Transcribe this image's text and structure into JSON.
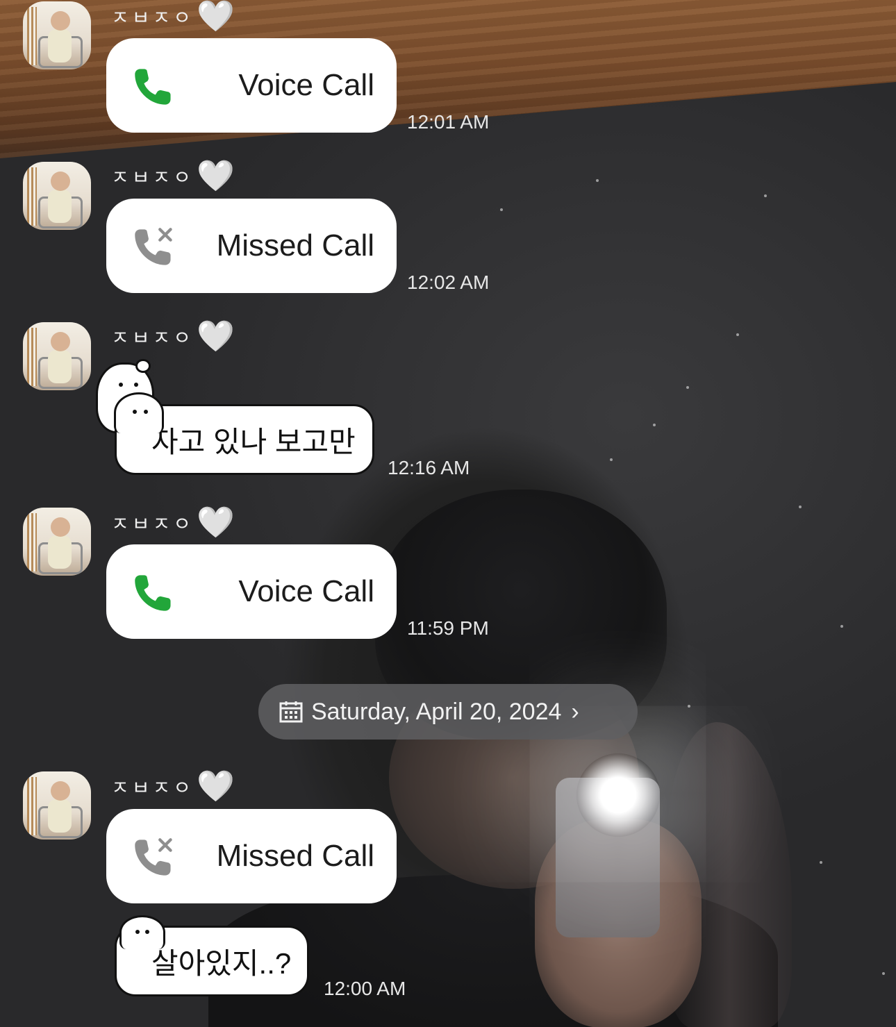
{
  "contact": {
    "name": "ㅈㅂㅈㅇ",
    "heart": "🤍"
  },
  "colors": {
    "call_green": "#22a63a",
    "missed_gray": "#8e8e8e",
    "bubble": "#ffffff"
  },
  "messages": [
    {
      "type": "call",
      "icon": "phone-icon",
      "label": "Voice Call",
      "time": "12:01 AM"
    },
    {
      "type": "call",
      "icon": "missed-call-icon",
      "label": "Missed Call",
      "time": "12:02 AM"
    },
    {
      "type": "sticker_text",
      "text": "자고 있나 보고만",
      "time": "12:16 AM"
    },
    {
      "type": "call",
      "icon": "phone-icon",
      "label": "Voice Call",
      "time": "11:59 PM"
    },
    {
      "type": "call",
      "icon": "missed-call-icon",
      "label": "Missed Call",
      "time": ""
    },
    {
      "type": "sticker_text",
      "text": "살아있지..?",
      "time": "12:00 AM"
    }
  ],
  "date_divider": {
    "icon": "calendar-icon",
    "label": "Saturday, April 20, 2024",
    "chevron": "›"
  }
}
